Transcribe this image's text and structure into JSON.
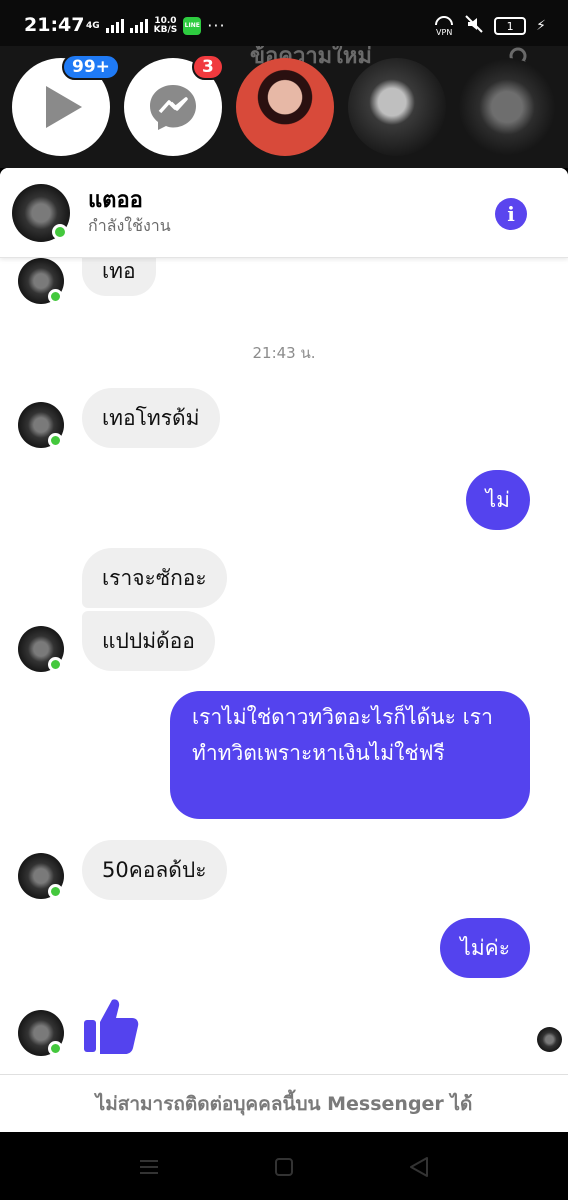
{
  "status_bar": {
    "time": "21:47",
    "network": "4G",
    "speed_value": "10.0",
    "speed_unit": "KB/S",
    "line_label": "LINE",
    "more": "···",
    "vpn": "VPN",
    "battery": "1"
  },
  "background_app": {
    "title_fragment": "ข้อความใหม่"
  },
  "chat_heads": [
    {
      "name": "video-head",
      "badge": "99+"
    },
    {
      "name": "messenger-head",
      "badge": "3"
    },
    {
      "name": "girl-photo-head",
      "badge": ""
    },
    {
      "name": "hoodie-photo-head",
      "badge": ""
    },
    {
      "name": "active-contact-head",
      "badge": ""
    }
  ],
  "conversation": {
    "contact_name": "แตออ",
    "contact_status": "กำลังใช้งาน",
    "messages": [
      {
        "dir": "in",
        "text": "เทอ"
      },
      {
        "dir": "time",
        "text": "21:43 น."
      },
      {
        "dir": "in",
        "text": "เทอโทรด้ม่"
      },
      {
        "dir": "out",
        "text": "ไม่"
      },
      {
        "dir": "in",
        "text": "เราจะซักอะ"
      },
      {
        "dir": "in",
        "text": "แปปม่ด้ออ"
      },
      {
        "dir": "out",
        "text": "เราไม่ใช่ดาวทวิตอะไรก็ได้นะ เราทำทวิตเพราะหาเงินไม่ใช่ฟรี"
      },
      {
        "dir": "in",
        "text": "50คอลด้ปะ"
      },
      {
        "dir": "out",
        "text": "ไม่ค่ะ"
      },
      {
        "dir": "in",
        "text": "👍"
      }
    ],
    "footer_notice": "ไม่สามารถติดต่อบุคคลนี้บน Messenger ได้"
  },
  "colors": {
    "accent": "#5443ee",
    "incoming_bubble": "#efefef",
    "online": "#44c83d",
    "badge_blue": "#1f7af5",
    "badge_red": "#f03a3e"
  }
}
